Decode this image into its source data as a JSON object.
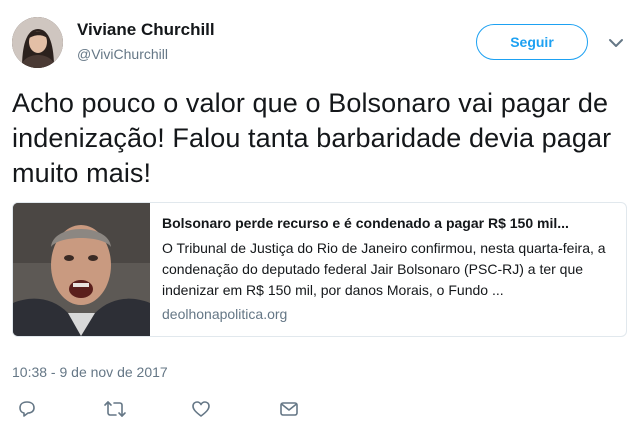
{
  "author": {
    "name": "Viviane Churchill",
    "handle": "@ViviChurchill"
  },
  "follow_button": {
    "label": "Seguir"
  },
  "tweet": {
    "text": "Acho pouco o valor que o Bolsonaro vai pagar de indenização! Falou tanta barbaridade devia pagar muito mais!",
    "timestamp": "10:38 - 9 de nov de 2017"
  },
  "card": {
    "title": "Bolsonaro perde recurso e é condenado a pagar R$ 150 mil...",
    "description": "O Tribunal de Justiça do Rio de Janeiro confirmou, nesta quarta-feira, a condenação do deputado federal Jair Bolsonaro (PSC-RJ) a ter que indenizar em R$ 150 mil, por danos Morais, o Fundo ...",
    "domain": "deolhonapolitica.org"
  },
  "actions": {
    "icons": [
      "reply-icon",
      "retweet-icon",
      "like-icon",
      "direct-message-icon"
    ]
  },
  "colors": {
    "accent": "#1da1f2",
    "text": "#14171a",
    "muted": "#657786",
    "border": "#e1e8ed"
  }
}
